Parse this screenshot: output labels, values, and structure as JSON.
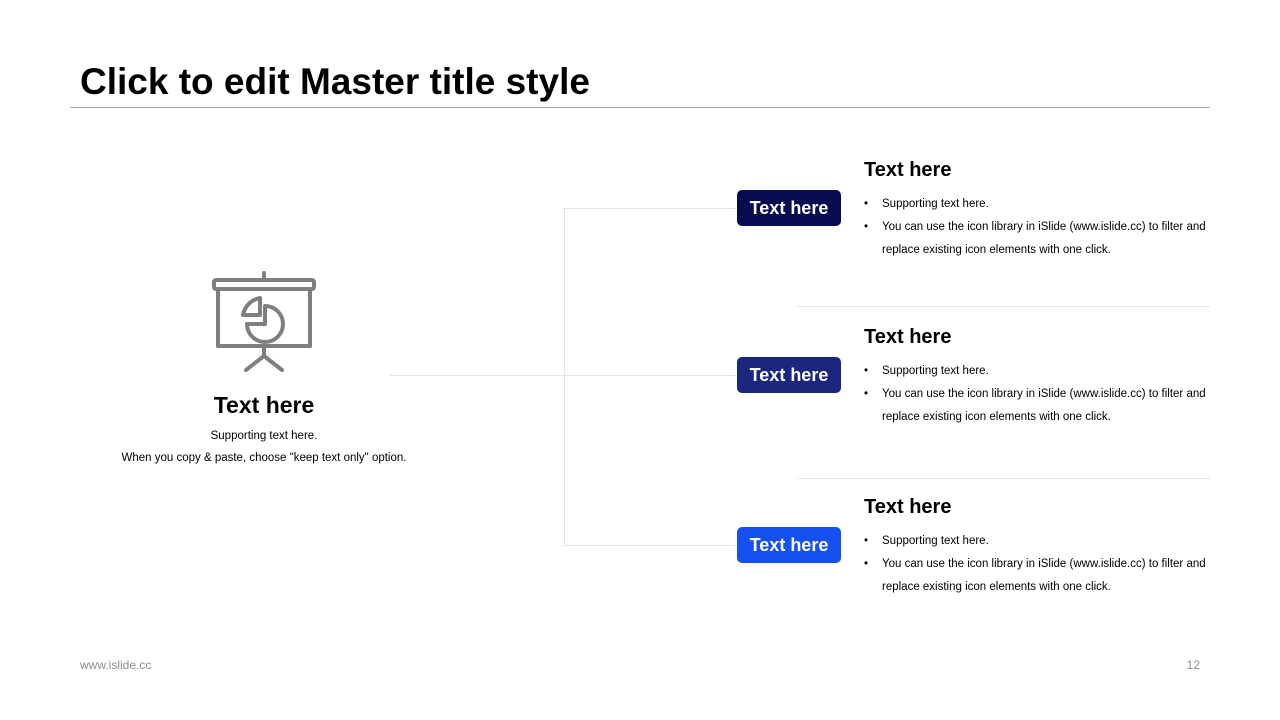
{
  "slide": {
    "title": "Click to edit Master title style",
    "footer_url": "www.islide.cc",
    "page_number": "12"
  },
  "center": {
    "icon": "presentation-pie-chart-icon",
    "title": "Text here",
    "subtext_line1": "Supporting text here.",
    "subtext_line2": "When you copy & paste, choose \"keep text only\" option."
  },
  "colors": {
    "pill_1": "#070b4f",
    "pill_2": "#1b267e",
    "pill_3": "#1750f0",
    "icon": "#7f7f7f",
    "connector": "#e3e3e3"
  },
  "items": [
    {
      "pill_label": "Text here",
      "title": "Text here",
      "bullets": [
        "Supporting text here.",
        "You can use the icon library in iSlide  (www.islide.cc) to filter and replace existing icon elements with one click."
      ]
    },
    {
      "pill_label": "Text here",
      "title": "Text here",
      "bullets": [
        "Supporting text here.",
        "You can use the icon library in iSlide  (www.islide.cc) to filter and replace existing icon elements with one click."
      ]
    },
    {
      "pill_label": "Text here",
      "title": "Text here",
      "bullets": [
        "Supporting text here.",
        "You can use the icon library in iSlide  (www.islide.cc) to filter and replace existing icon elements with one click."
      ]
    }
  ]
}
